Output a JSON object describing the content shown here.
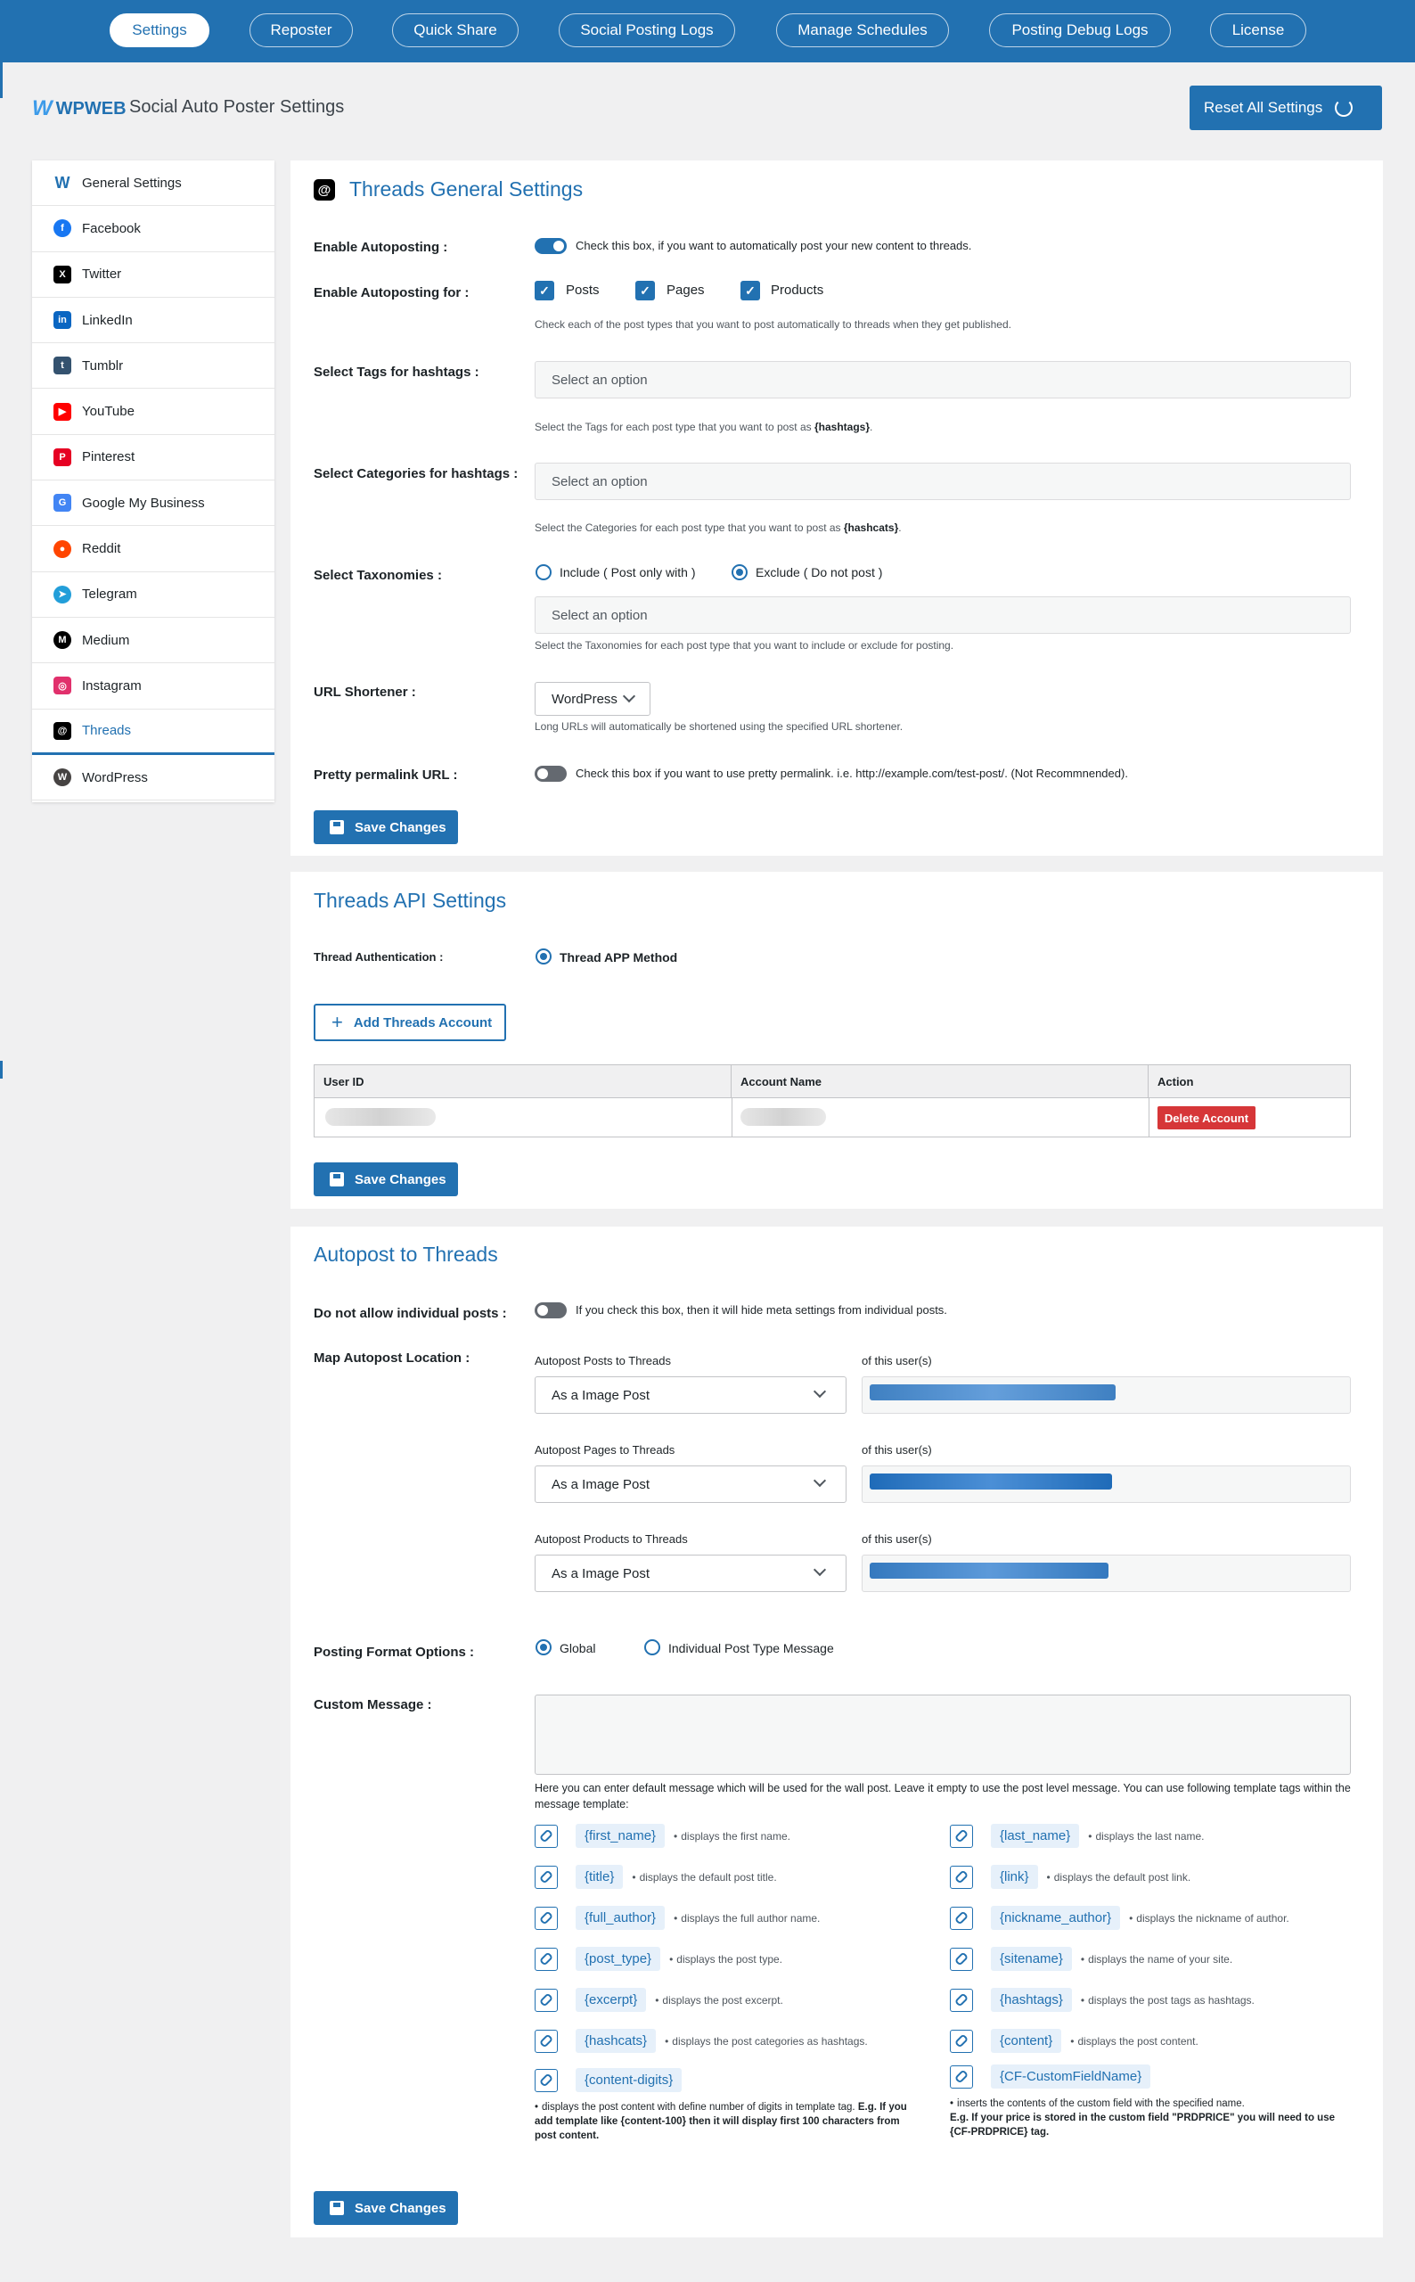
{
  "nav": {
    "tabs": [
      {
        "label": "Settings",
        "active": true
      },
      {
        "label": "Reposter"
      },
      {
        "label": "Quick Share"
      },
      {
        "label": "Social Posting Logs"
      },
      {
        "label": "Manage Schedules"
      },
      {
        "label": "Posting Debug Logs"
      },
      {
        "label": "License"
      }
    ]
  },
  "header": {
    "logo_text": "WPWEB",
    "title": "Social Auto Poster Settings",
    "reset_label": "Reset All Settings"
  },
  "sidebar": {
    "items": [
      {
        "label": "General Settings",
        "icon": "wpweb-icon",
        "color": "#2271b1"
      },
      {
        "label": "Facebook",
        "icon": "facebook-icon",
        "color": "#1877f2"
      },
      {
        "label": "Twitter",
        "icon": "x-icon",
        "color": "#000000"
      },
      {
        "label": "LinkedIn",
        "icon": "linkedin-icon",
        "color": "#0a66c2"
      },
      {
        "label": "Tumblr",
        "icon": "tumblr-icon",
        "color": "#34526f"
      },
      {
        "label": "YouTube",
        "icon": "youtube-icon",
        "color": "#ff0000"
      },
      {
        "label": "Pinterest",
        "icon": "pinterest-icon",
        "color": "#e60023"
      },
      {
        "label": "Google My Business",
        "icon": "google-business-icon",
        "color": "#4285f4"
      },
      {
        "label": "Reddit",
        "icon": "reddit-icon",
        "color": "#ff4500"
      },
      {
        "label": "Telegram",
        "icon": "telegram-icon",
        "color": "#229ed9"
      },
      {
        "label": "Medium",
        "icon": "medium-icon",
        "color": "#000000"
      },
      {
        "label": "Instagram",
        "icon": "instagram-icon",
        "color": "#e1306c"
      },
      {
        "label": "Threads",
        "icon": "threads-icon",
        "color": "#000000",
        "active": true
      },
      {
        "label": "WordPress",
        "icon": "wordpress-icon",
        "color": "#464342"
      }
    ]
  },
  "general": {
    "title": "Threads General Settings",
    "enable_autoposting_label": "Enable Autoposting :",
    "enable_autoposting_desc": "Check this box, if you want to automatically post your new content to threads.",
    "enable_for_label": "Enable Autoposting for :",
    "post_types": [
      "Posts",
      "Pages",
      "Products"
    ],
    "enable_for_desc": "Check each of the post types that you want to post automatically to threads when they get published.",
    "tags_label": "Select Tags for hashtags :",
    "tags_placeholder": "Select an option",
    "tags_desc_pre": "Select the Tags for each post type that you want to post as ",
    "tags_desc_bold": "{hashtags}",
    "tags_desc_post": ".",
    "cats_label": "Select Categories for hashtags :",
    "cats_placeholder": "Select an option",
    "cats_desc_pre": "Select the Categories for each post type that you want to post as ",
    "cats_desc_bold": "{hashcats}",
    "cats_desc_post": ".",
    "tax_label": "Select Taxonomies :",
    "tax_include": "Include ( Post only with )",
    "tax_exclude": "Exclude ( Do not post )",
    "tax_placeholder": "Select an option",
    "tax_desc": "Select the Taxonomies for each post type that you want to include or exclude for posting.",
    "shortener_label": "URL Shortener :",
    "shortener_value": "WordPress",
    "shortener_desc": "Long URLs will automatically be shortened using the specified URL shortener.",
    "pretty_label": "Pretty permalink URL :",
    "pretty_desc": "Check this box if you want to use pretty permalink. i.e. http://example.com/test-post/. (Not Recommnended).",
    "save_label": "Save Changes"
  },
  "api": {
    "title": "Threads API Settings",
    "auth_label": "Thread Authentication :",
    "auth_method": "Thread APP Method",
    "add_account_label": "Add Threads Account",
    "columns": [
      "User ID",
      "Account Name",
      "Action"
    ],
    "delete_label": "Delete Account",
    "save_label": "Save Changes"
  },
  "autopost": {
    "title": "Autopost to Threads",
    "no_individual_label": "Do not allow individual posts :",
    "no_individual_desc": "If you check this box, then it will hide meta settings from individual posts.",
    "map_label": "Map Autopost Location :",
    "maps": [
      {
        "label": "Autopost Posts to Threads",
        "value": "As a Image Post",
        "user_label": "of this user(s)"
      },
      {
        "label": "Autopost Pages to Threads",
        "value": "As a Image Post",
        "user_label": "of this user(s)"
      },
      {
        "label": "Autopost Products to Threads",
        "value": "As a Image Post",
        "user_label": "of this user(s)"
      }
    ],
    "format_label": "Posting Format Options :",
    "format_global": "Global",
    "format_individual": "Individual Post Type Message",
    "custom_label": "Custom Message :",
    "custom_desc": "Here you can enter default message which will be used for the wall post. Leave it empty to use the post level message. You can use following template tags within the message template:",
    "tags_left": [
      {
        "tag": "{first_name}",
        "desc": "displays the first name."
      },
      {
        "tag": "{title}",
        "desc": "displays the default post title."
      },
      {
        "tag": "{full_author}",
        "desc": "displays the full author name."
      },
      {
        "tag": "{post_type}",
        "desc": "displays the post type."
      },
      {
        "tag": "{excerpt}",
        "desc": "displays the post excerpt."
      },
      {
        "tag": "{hashcats}",
        "desc": "displays the post categories as hashtags."
      }
    ],
    "tags_right": [
      {
        "tag": "{last_name}",
        "desc": "displays the last name."
      },
      {
        "tag": "{link}",
        "desc": "displays the default post link."
      },
      {
        "tag": "{nickname_author}",
        "desc": "displays the nickname of author."
      },
      {
        "tag": "{sitename}",
        "desc": "displays the name of your site."
      },
      {
        "tag": "{hashtags}",
        "desc": "displays the post tags as hashtags."
      },
      {
        "tag": "{content}",
        "desc": "displays the post content."
      }
    ],
    "digits_tag": "{content-digits}",
    "digits_desc_1": "displays the post content with define number of digits in template tag. ",
    "digits_desc_bold": "E.g. If you add template like {content-100} then it will display first 100 characters from post content.",
    "cf_tag": "{CF-CustomFieldName}",
    "cf_desc_1": "inserts the contents of the custom field with the specified name.",
    "cf_desc_bold": "E.g. If your price is stored in the custom field \"PRDPRICE\" you will need to use {CF-PRDPRICE} tag.",
    "save_label": "Save Changes"
  }
}
